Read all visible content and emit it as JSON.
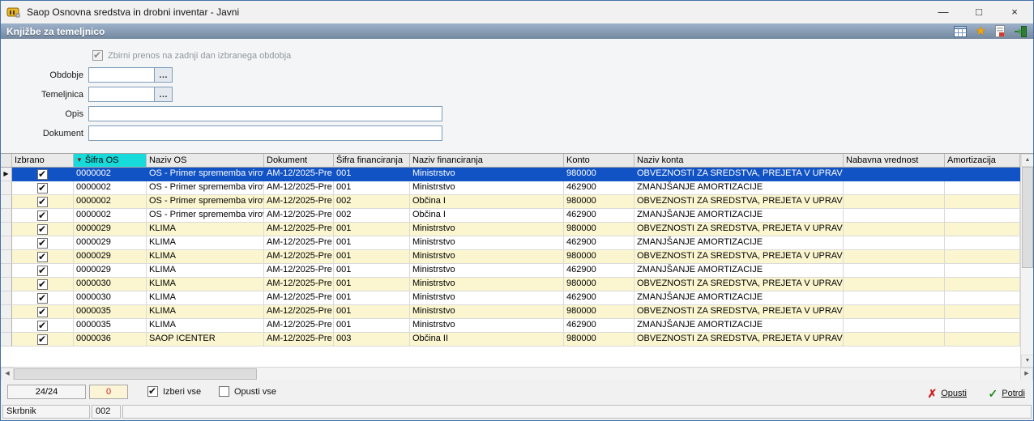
{
  "window": {
    "title": "Saop Osnovna sredstva in drobni inventar - Javni",
    "controls": {
      "minimize": "—",
      "maximize": "□",
      "close": "×"
    }
  },
  "header": {
    "title": "Knjižbe za temeljnico"
  },
  "form": {
    "summary_checkbox": {
      "label": "Zbirni prenos na zadnji dan izbranega obdobja",
      "checked": true,
      "disabled": true
    },
    "fields": [
      {
        "label": "Obdobje",
        "value": "",
        "picker": "…"
      },
      {
        "label": "Temeljnica",
        "value": "",
        "picker": "…"
      },
      {
        "label": "Opis",
        "value": ""
      },
      {
        "label": "Dokument",
        "value": ""
      }
    ]
  },
  "grid": {
    "sort_indicator": "▼",
    "row_pointer": "▶",
    "columns": [
      {
        "key": "izbrano",
        "label": "Izbrano"
      },
      {
        "key": "sifra_os",
        "label": "Šifra OS",
        "sorted": "desc"
      },
      {
        "key": "naziv_os",
        "label": "Naziv OS"
      },
      {
        "key": "dokument",
        "label": "Dokument"
      },
      {
        "key": "sifra_fin",
        "label": "Šifra financiranja"
      },
      {
        "key": "naziv_fin",
        "label": "Naziv financiranja"
      },
      {
        "key": "konto",
        "label": "Konto"
      },
      {
        "key": "naziv_konta",
        "label": "Naziv konta"
      },
      {
        "key": "nabavna",
        "label": "Nabavna vrednost"
      },
      {
        "key": "amort",
        "label": "Amortizacija"
      }
    ],
    "rows": [
      {
        "selected": true,
        "checked": true,
        "cells": {
          "sifra_os": "0000002",
          "naziv_os": "OS - Primer sprememba virov",
          "dokument": "AM-12/2025-Pre",
          "sifra_fin": "001",
          "naziv_fin": "Ministrstvo",
          "konto": "980000",
          "naziv_konta": "OBVEZNOSTI ZA SREDSTVA, PREJETA V UPRAVLJANJ",
          "nabavna": "",
          "amort": ""
        }
      },
      {
        "selected": false,
        "checked": true,
        "cells": {
          "sifra_os": "0000002",
          "naziv_os": "OS - Primer sprememba virov",
          "dokument": "AM-12/2025-Pre",
          "sifra_fin": "001",
          "naziv_fin": "Ministrstvo",
          "konto": "462900",
          "naziv_konta": "ZMANJŠANJE AMORTIZACIJE",
          "nabavna": "",
          "amort": ""
        }
      },
      {
        "selected": false,
        "checked": true,
        "cells": {
          "sifra_os": "0000002",
          "naziv_os": "OS - Primer sprememba virov",
          "dokument": "AM-12/2025-Pre",
          "sifra_fin": "002",
          "naziv_fin": "Občina I",
          "konto": "980000",
          "naziv_konta": "OBVEZNOSTI ZA SREDSTVA, PREJETA V UPRAVLJANJ",
          "nabavna": "",
          "amort": ""
        }
      },
      {
        "selected": false,
        "checked": true,
        "cells": {
          "sifra_os": "0000002",
          "naziv_os": "OS - Primer sprememba virov",
          "dokument": "AM-12/2025-Pre",
          "sifra_fin": "002",
          "naziv_fin": "Občina I",
          "konto": "462900",
          "naziv_konta": "ZMANJŠANJE AMORTIZACIJE",
          "nabavna": "",
          "amort": ""
        }
      },
      {
        "selected": false,
        "checked": true,
        "cells": {
          "sifra_os": "0000029",
          "naziv_os": "KLIMA",
          "dokument": "AM-12/2025-Pre",
          "sifra_fin": "001",
          "naziv_fin": "Ministrstvo",
          "konto": "980000",
          "naziv_konta": "OBVEZNOSTI ZA SREDSTVA, PREJETA V UPRAVLJANJ",
          "nabavna": "",
          "amort": ""
        }
      },
      {
        "selected": false,
        "checked": true,
        "cells": {
          "sifra_os": "0000029",
          "naziv_os": "KLIMA",
          "dokument": "AM-12/2025-Pre",
          "sifra_fin": "001",
          "naziv_fin": "Ministrstvo",
          "konto": "462900",
          "naziv_konta": "ZMANJŠANJE AMORTIZACIJE",
          "nabavna": "",
          "amort": ""
        }
      },
      {
        "selected": false,
        "checked": true,
        "cells": {
          "sifra_os": "0000029",
          "naziv_os": "KLIMA",
          "dokument": "AM-12/2025-Pre",
          "sifra_fin": "001",
          "naziv_fin": "Ministrstvo",
          "konto": "980000",
          "naziv_konta": "OBVEZNOSTI ZA SREDSTVA, PREJETA V UPRAVLJANJ",
          "nabavna": "",
          "amort": ""
        }
      },
      {
        "selected": false,
        "checked": true,
        "cells": {
          "sifra_os": "0000029",
          "naziv_os": "KLIMA",
          "dokument": "AM-12/2025-Pre",
          "sifra_fin": "001",
          "naziv_fin": "Ministrstvo",
          "konto": "462900",
          "naziv_konta": "ZMANJŠANJE AMORTIZACIJE",
          "nabavna": "",
          "amort": ""
        }
      },
      {
        "selected": false,
        "checked": true,
        "cells": {
          "sifra_os": "0000030",
          "naziv_os": "KLIMA",
          "dokument": "AM-12/2025-Pre",
          "sifra_fin": "001",
          "naziv_fin": "Ministrstvo",
          "konto": "980000",
          "naziv_konta": "OBVEZNOSTI ZA SREDSTVA, PREJETA V UPRAVLJANJ",
          "nabavna": "",
          "amort": ""
        }
      },
      {
        "selected": false,
        "checked": true,
        "cells": {
          "sifra_os": "0000030",
          "naziv_os": "KLIMA",
          "dokument": "AM-12/2025-Pre",
          "sifra_fin": "001",
          "naziv_fin": "Ministrstvo",
          "konto": "462900",
          "naziv_konta": "ZMANJŠANJE AMORTIZACIJE",
          "nabavna": "",
          "amort": ""
        }
      },
      {
        "selected": false,
        "checked": true,
        "cells": {
          "sifra_os": "0000035",
          "naziv_os": "KLIMA",
          "dokument": "AM-12/2025-Pre",
          "sifra_fin": "001",
          "naziv_fin": "Ministrstvo",
          "konto": "980000",
          "naziv_konta": "OBVEZNOSTI ZA SREDSTVA, PREJETA V UPRAVLJANJ",
          "nabavna": "",
          "amort": ""
        }
      },
      {
        "selected": false,
        "checked": true,
        "cells": {
          "sifra_os": "0000035",
          "naziv_os": "KLIMA",
          "dokument": "AM-12/2025-Pre",
          "sifra_fin": "001",
          "naziv_fin": "Ministrstvo",
          "konto": "462900",
          "naziv_konta": "ZMANJŠANJE AMORTIZACIJE",
          "nabavna": "",
          "amort": ""
        }
      },
      {
        "selected": false,
        "checked": true,
        "cells": {
          "sifra_os": "0000036",
          "naziv_os": "SAOP ICENTER",
          "dokument": "AM-12/2025-Pre",
          "sifra_fin": "003",
          "naziv_fin": "Občina II",
          "konto": "980000",
          "naziv_konta": "OBVEZNOSTI ZA SREDSTVA, PREJETA V UPRAVLJANJ",
          "nabavna": "",
          "amort": ""
        }
      }
    ]
  },
  "footer": {
    "record_counter": "24/24",
    "secondary_counter": "0",
    "select_all": {
      "label": "Izberi vse",
      "checked": true
    },
    "deselect_all": {
      "label": "Opusti vse",
      "checked": false
    },
    "cancel": {
      "label": "Opusti",
      "icon": "✗"
    },
    "confirm": {
      "label": "Potrdi",
      "icon": "✓"
    }
  },
  "statusbar": {
    "user": "Skrbnik",
    "value": "002"
  },
  "icons": {
    "scroll_up": "▲",
    "scroll_down": "▼",
    "scroll_left": "◀",
    "scroll_right": "▶"
  },
  "colors": {
    "selection": "#1153c4",
    "rowalt": "#fbf6cf",
    "sortheader": "#17dbdb",
    "cancel": "#cc2222",
    "confirm": "#1e8a1e",
    "headertop": "#9db1ca",
    "headerbottom": "#74889f"
  }
}
